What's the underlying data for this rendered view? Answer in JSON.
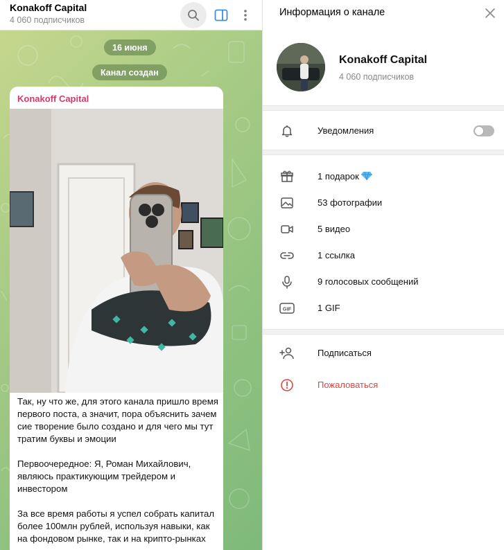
{
  "chat": {
    "title": "Konakoff Capital",
    "subscribers": "4 060 подписчиков",
    "date_pill": "16 июня",
    "service_pill": "Канал создан",
    "message": {
      "author": "Konakoff Capital",
      "paragraphs": [
        "Так, ну что же, для этого канала пришло время первого поста, а значит, пора объяснить зачем сие творение было создано и для чего мы тут тратим буквы и эмоции",
        "Первоочередное: Я, Роман Михайлович, являюсь практикующим трейдером и инвестором",
        "За все время работы я успел собрать капитал более 100млн рублей, используя навыки, как на фондовом рынке, так и на крипто-рынках"
      ]
    }
  },
  "info": {
    "panel_title": "Информация о канале",
    "channel_name": "Konakoff Capital",
    "subscribers": "4 060 подписчиков",
    "notifications": {
      "label": "Уведомления",
      "enabled": false
    },
    "media": [
      {
        "icon": "gift-icon",
        "label": "1 подарок"
      },
      {
        "icon": "photo-icon",
        "label": "53 фотографии"
      },
      {
        "icon": "video-icon",
        "label": "5 видео"
      },
      {
        "icon": "link-icon",
        "label": "1 ссылка"
      },
      {
        "icon": "mic-icon",
        "label": "9 голосовых сообщений"
      },
      {
        "icon": "gif-icon",
        "label": "1 GIF"
      }
    ],
    "actions": [
      {
        "icon": "add-user-icon",
        "label": "Подписаться"
      },
      {
        "icon": "report-icon",
        "label": "Пожаловаться"
      }
    ]
  },
  "colors": {
    "author": "#d13a6b",
    "danger": "#e0463e",
    "accent": "#3a8fd8",
    "chat_bg": "#9fc883"
  }
}
